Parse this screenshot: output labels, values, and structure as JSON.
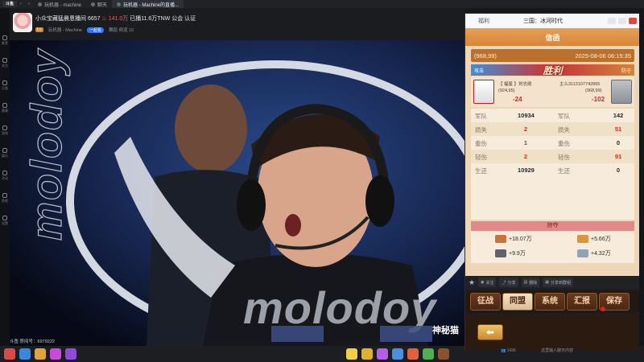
{
  "browser": {
    "tabs": [
      {
        "label": "玩机器 - machine",
        "active": false
      },
      {
        "label": "聊天",
        "active": false
      },
      {
        "label": "玩机器 - Machine的直播...",
        "active": true
      }
    ]
  },
  "rail": {
    "items": [
      "推荐",
      "关注",
      "分类",
      "赛事",
      "游戏",
      "娱乐",
      "活动",
      "鱼吧",
      "设置"
    ]
  },
  "streamer": {
    "title": "小众宝藏猛晨恩播间 6657",
    "stats": "141.0万",
    "heat": "已播11.6万TNW",
    "extra": "公会 认证",
    "name": "玩机器 - Machine",
    "tag": "一起看",
    "room_label": "舞蹈 频道 15"
  },
  "video": {
    "overlay_text": "molodoy",
    "vertical_text": "molodoy",
    "corner_label": "神秘猫"
  },
  "room": {
    "number_label": "斗鱼 房间号：6979222"
  },
  "panel": {
    "header_left": "福利",
    "header_center": "三国：冰河时代",
    "letter_title": "信函",
    "coords": "(968,99)",
    "datetime": "2025-08-06 06:15:35",
    "attack_label": "攻击",
    "result": "胜利",
    "defend_label": "防守",
    "attacker": {
      "tag": "【 福星 】刘志勋",
      "coords": "(924,95)",
      "score": "-24"
    },
    "defender": {
      "tag": "主么3113107742865",
      "coords": "(968,99)",
      "score": "-102"
    },
    "stats": [
      {
        "l1": "军队",
        "v1": "10934",
        "l2": "军队",
        "v2": "142",
        "red": false
      },
      {
        "l1": "损失",
        "v1": "2",
        "l2": "损失",
        "v2": "51",
        "red": true
      },
      {
        "l1": "重伤",
        "v1": "1",
        "l2": "重伤",
        "v2": "0",
        "red": true
      },
      {
        "l1": "轻伤",
        "v1": "2",
        "l2": "轻伤",
        "v2": "91",
        "red": true
      },
      {
        "l1": "生还",
        "v1": "10929",
        "l2": "生还",
        "v2": "0",
        "red": false
      }
    ],
    "loot_title": "掠夺",
    "loot": [
      "+18.07万",
      "+5.66万",
      "+9.9万",
      "+4.32万"
    ],
    "actions": [
      "关注",
      "分享",
      "删除",
      "分享到群组"
    ],
    "tabs": [
      "征战",
      "同盟",
      "系统",
      "汇报",
      "保存"
    ],
    "selected_tab": "同盟"
  },
  "chat": {
    "viewer_count": "1436",
    "input_placeholder": "这里输入聊天内容"
  },
  "colors": {
    "accent": "#2d73ff",
    "win_red": "#c83a3a",
    "letter_orange": "#d98538",
    "paper": "#eed6b8"
  }
}
